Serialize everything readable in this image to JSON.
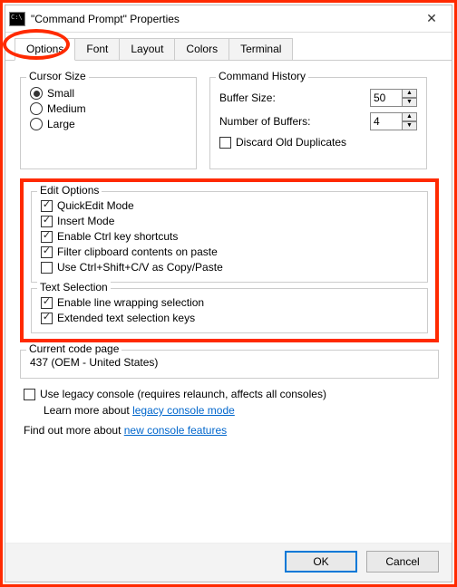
{
  "window": {
    "title": "\"Command Prompt\" Properties"
  },
  "tabs": {
    "options": "Options",
    "font": "Font",
    "layout": "Layout",
    "colors": "Colors",
    "terminal": "Terminal"
  },
  "cursor": {
    "title": "Cursor Size",
    "small": "Small",
    "medium": "Medium",
    "large": "Large"
  },
  "history": {
    "title": "Command History",
    "buffer_label": "Buffer Size:",
    "buffer_value": "50",
    "numbuf_label": "Number of Buffers:",
    "numbuf_value": "4",
    "discard": "Discard Old Duplicates"
  },
  "edit": {
    "title": "Edit Options",
    "quickedit": "QuickEdit Mode",
    "insert": "Insert Mode",
    "ctrl": "Enable Ctrl key shortcuts",
    "filter": "Filter clipboard contents on paste",
    "ctrlshift": "Use Ctrl+Shift+C/V as Copy/Paste"
  },
  "textsel": {
    "title": "Text Selection",
    "linewrap": "Enable line wrapping selection",
    "extkeys": "Extended text selection keys"
  },
  "codepage": {
    "title": "Current code page",
    "value": "437   (OEM - United States)"
  },
  "legacy": {
    "label": "Use legacy console (requires relaunch, affects all consoles)",
    "learn_prefix": "Learn more about ",
    "learn_link": "legacy console mode"
  },
  "findout": {
    "prefix": "Find out more about ",
    "link": "new console features"
  },
  "buttons": {
    "ok": "OK",
    "cancel": "Cancel"
  }
}
